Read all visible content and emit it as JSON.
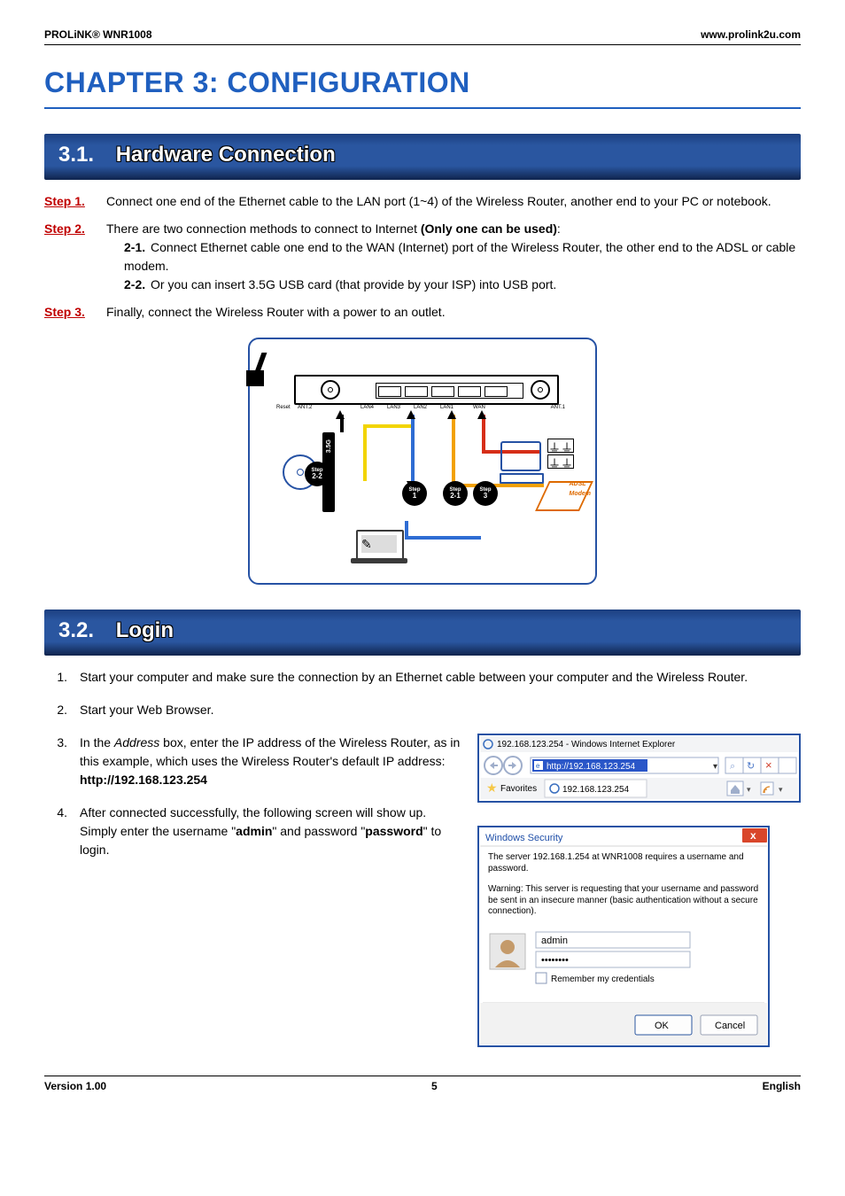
{
  "header": {
    "left": "PROLiNK® WNR1008",
    "right": "www.prolink2u.com"
  },
  "chapter_title": "CHAPTER 3: CONFIGURATION",
  "section31": {
    "num": "3.1.",
    "title": "Hardware Connection"
  },
  "step1": {
    "label": "Step 1.",
    "body": "Connect one end of the Ethernet cable to the LAN port (1~4) of the Wireless Router, another end to your PC or notebook."
  },
  "step2": {
    "label": "Step 2.",
    "intro_pre": "There are two connection methods to connect to Internet ",
    "intro_bold": "(Only one can be used)",
    "intro_post": ":",
    "s21_num": "2-1.",
    "s21": " Connect Ethernet cable one end to the WAN (Internet) port of the Wireless Router,  the other end to the ADSL or cable modem.",
    "s22_num": "2-2.",
    "s22": " Or you can insert 3.5G USB card (that provide by your ISP) into USB port."
  },
  "step3": {
    "label": "Step 3.",
    "body": "Finally, connect the Wireless Router with a power to an outlet."
  },
  "diagram": {
    "ant2": "ANT.2",
    "ant1": "ANT.1",
    "reset": "Reset",
    "lan4": "LAN4",
    "lan3": "LAN3",
    "lan2": "LAN2",
    "lan1": "LAN1",
    "wan": "WAN",
    "step": "Step",
    "threeg": "3.5G",
    "adsl": "ADSL",
    "modem": "Modem"
  },
  "section32": {
    "num": "3.2.",
    "title": "Login"
  },
  "login": {
    "i1_n": "1.",
    "i1": "Start your computer and make sure the connection by an Ethernet cable between your computer and the Wireless Router.",
    "i2_n": "2.",
    "i2": "Start your Web Browser.",
    "i3_n": "3.",
    "i3_a": "In the ",
    "i3_addr": "Address",
    "i3_b": " box, enter the IP address of the Wireless Router, as in this example, which uses the Wireless Router's default IP address: ",
    "i3_url": "http://192.168.123.254",
    "i4_n": "4.",
    "i4_a": "After connected successfully, the following screen will show up. Simply enter the username \"",
    "i4_u": "admin",
    "i4_b": "\" and password \"",
    "i4_p": "password",
    "i4_c": "\" to login."
  },
  "ie": {
    "title": "192.168.123.254 - Windows Internet Explorer",
    "url": "http://192.168.123.254",
    "fav": "Favorites",
    "tab": "192.168.123.254"
  },
  "dialog": {
    "title": "Windows Security",
    "msg1": "The server 192.168.1.254 at WNR1008 requires a username and password.",
    "msg2": "Warning: This server is requesting that your username and password be sent in an insecure manner (basic authentication without a secure connection).",
    "user": "admin",
    "pass": "••••••••",
    "remember": "Remember my credentials",
    "ok": "OK",
    "cancel": "Cancel"
  },
  "footer": {
    "ver": "Version 1.00",
    "page": "5",
    "lang": "English"
  }
}
